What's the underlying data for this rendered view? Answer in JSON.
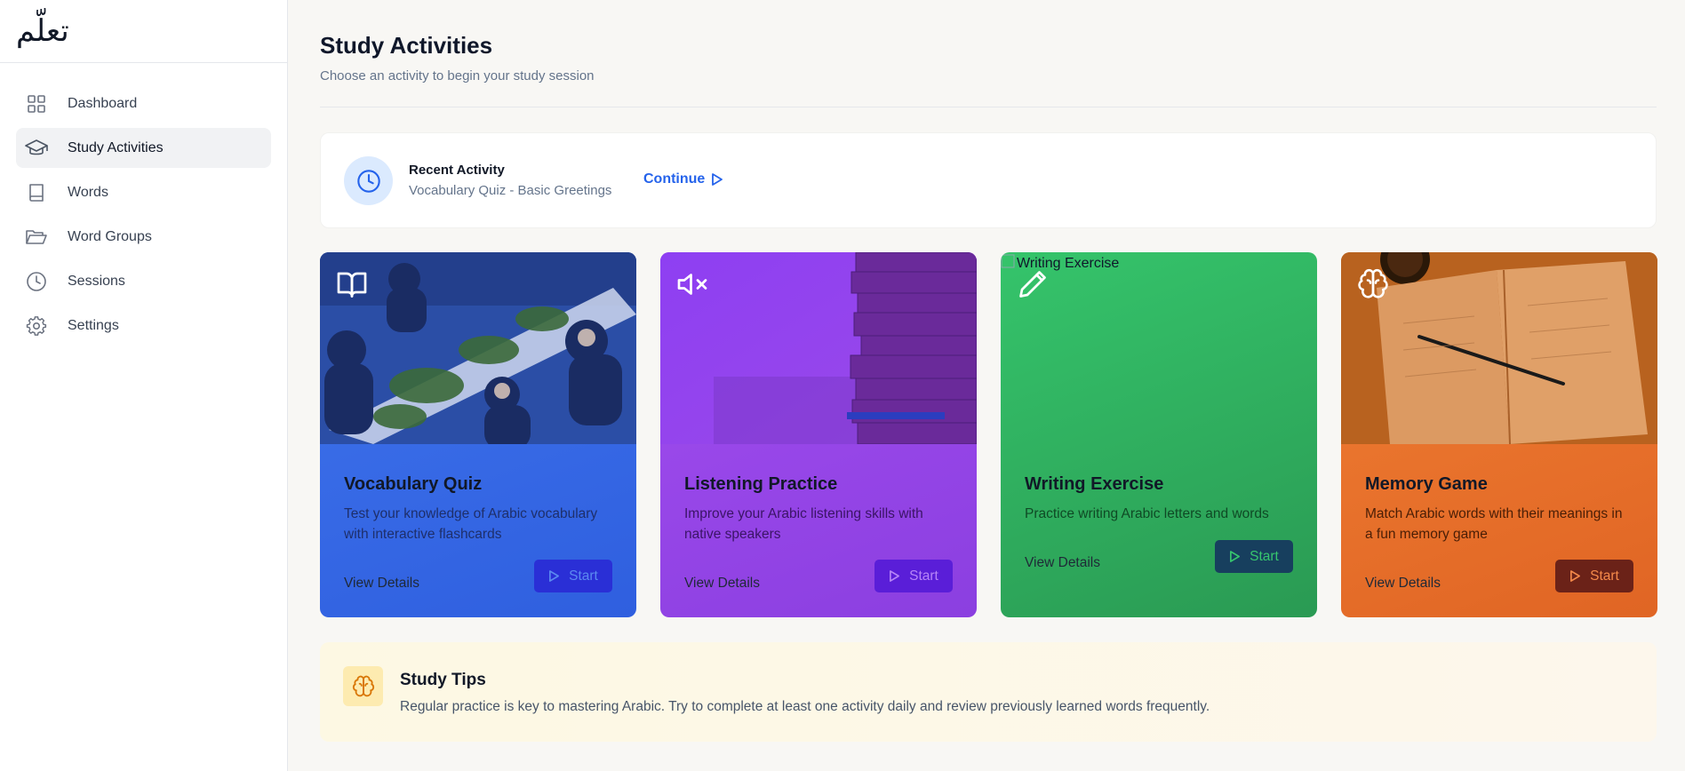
{
  "app": {
    "logo_text": "تعلّم"
  },
  "sidebar": {
    "items": [
      {
        "label": "Dashboard",
        "icon": "dashboard-grid-icon",
        "active": false
      },
      {
        "label": "Study Activities",
        "icon": "graduation-cap-icon",
        "active": true
      },
      {
        "label": "Words",
        "icon": "book-icon",
        "active": false
      },
      {
        "label": "Word Groups",
        "icon": "folder-open-icon",
        "active": false
      },
      {
        "label": "Sessions",
        "icon": "clock-icon",
        "active": false
      },
      {
        "label": "Settings",
        "icon": "gear-icon",
        "active": false
      }
    ]
  },
  "header": {
    "title": "Study Activities",
    "subtitle": "Choose an activity to begin your study session"
  },
  "recent": {
    "title": "Recent Activity",
    "subtitle": "Vocabulary Quiz - Basic Greetings",
    "continue_label": "Continue",
    "icon": "clock-icon"
  },
  "activities": [
    {
      "title": "Vocabulary Quiz",
      "description": "Test your knowledge of Arabic vocabulary with interactive flashcards",
      "details_label": "View Details",
      "start_label": "Start",
      "icon": "open-book-icon",
      "color": "#3b6ff0"
    },
    {
      "title": "Listening Practice",
      "description": "Improve your Arabic listening skills with native speakers",
      "details_label": "View Details",
      "start_label": "Start",
      "icon": "volume-mute-icon",
      "color": "#9d4bef"
    },
    {
      "title": "Writing Exercise",
      "description": "Practice writing Arabic letters and words",
      "details_label": "View Details",
      "start_label": "Start",
      "icon": "pencil-icon",
      "image_alt": "Writing Exercise",
      "color": "#34c06a"
    },
    {
      "title": "Memory Game",
      "description": "Match Arabic words with their meanings in a fun memory game",
      "details_label": "View Details",
      "start_label": "Start",
      "icon": "brain-icon",
      "color": "#ee7a31"
    }
  ],
  "tips": {
    "title": "Study Tips",
    "text": "Regular practice is key to mastering Arabic. Try to complete at least one activity daily and review previously learned words frequently.",
    "icon": "brain-icon"
  }
}
